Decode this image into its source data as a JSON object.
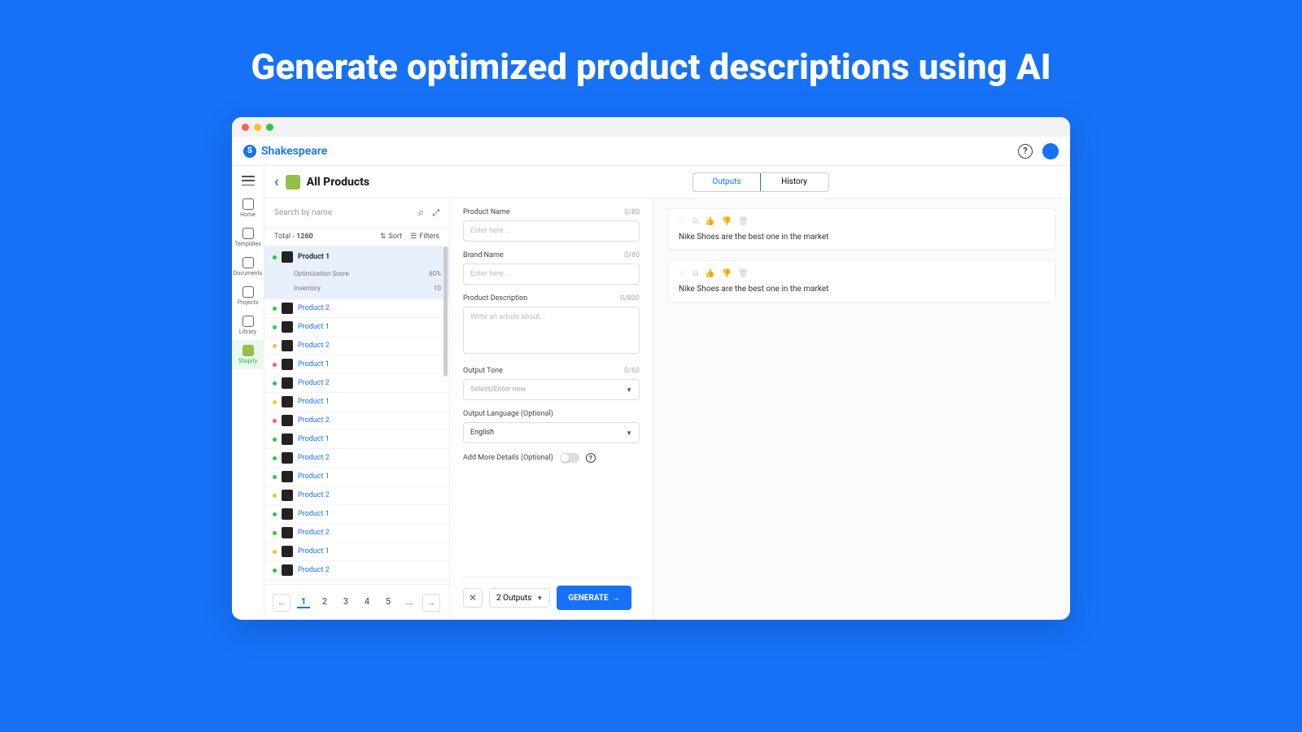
{
  "hero": "Generate optimized product descriptions using AI",
  "brand": "Shakespeare",
  "sidebar": {
    "items": [
      {
        "label": "Home"
      },
      {
        "label": "Templates"
      },
      {
        "label": "Documents"
      },
      {
        "label": "Projects"
      },
      {
        "label": "Library"
      },
      {
        "label": "Shopify"
      }
    ]
  },
  "header": {
    "title": "All Products",
    "tabs": {
      "outputs": "Outputs",
      "history": "History"
    }
  },
  "products": {
    "search_placeholder": "Search by name",
    "total_label": "Total - ",
    "total_count": "1260",
    "sort_label": "Sort",
    "filters_label": "Filters",
    "selected": {
      "name": "Product 1",
      "opt_label": "Optimization Score",
      "opt_value": "60%",
      "inv_label": "Inventory",
      "inv_value": "10"
    },
    "rows": [
      {
        "status": "g",
        "name": "Product 2"
      },
      {
        "status": "g",
        "name": "Product 1"
      },
      {
        "status": "y",
        "name": "Product 2"
      },
      {
        "status": "r",
        "name": "Product 1"
      },
      {
        "status": "g",
        "name": "Product 2"
      },
      {
        "status": "y",
        "name": "Product 1"
      },
      {
        "status": "r",
        "name": "Product 2"
      },
      {
        "status": "g",
        "name": "Product 1"
      },
      {
        "status": "g",
        "name": "Product 2"
      },
      {
        "status": "g",
        "name": "Product 1"
      },
      {
        "status": "y",
        "name": "Product 2"
      },
      {
        "status": "g",
        "name": "Product 1"
      },
      {
        "status": "g",
        "name": "Product 2"
      },
      {
        "status": "y",
        "name": "Product 1"
      },
      {
        "status": "g",
        "name": "Product 2"
      }
    ],
    "pages": [
      "1",
      "2",
      "3",
      "4",
      "5",
      "..."
    ]
  },
  "form": {
    "product_name": {
      "label": "Product Name",
      "count": "0/80",
      "placeholder": "Enter here ..."
    },
    "brand_name": {
      "label": "Brand Name",
      "count": "0/80",
      "placeholder": "Enter here ..."
    },
    "description": {
      "label": "Product Description",
      "count": "0/800",
      "placeholder": "Write an article about..."
    },
    "tone": {
      "label": "Output Tone",
      "count": "0/60",
      "placeholder": "Select/Enter new"
    },
    "language": {
      "label": "Output Language (Optional)",
      "value": "English"
    },
    "more_details": "Add More Details (Optional)",
    "outputs_count": "2 Outputs",
    "generate": "GENERATE"
  },
  "outputs": [
    {
      "text": "Nike Shoes are the best one in the market"
    },
    {
      "text": "Nike Shoes are the best one in the market"
    }
  ]
}
